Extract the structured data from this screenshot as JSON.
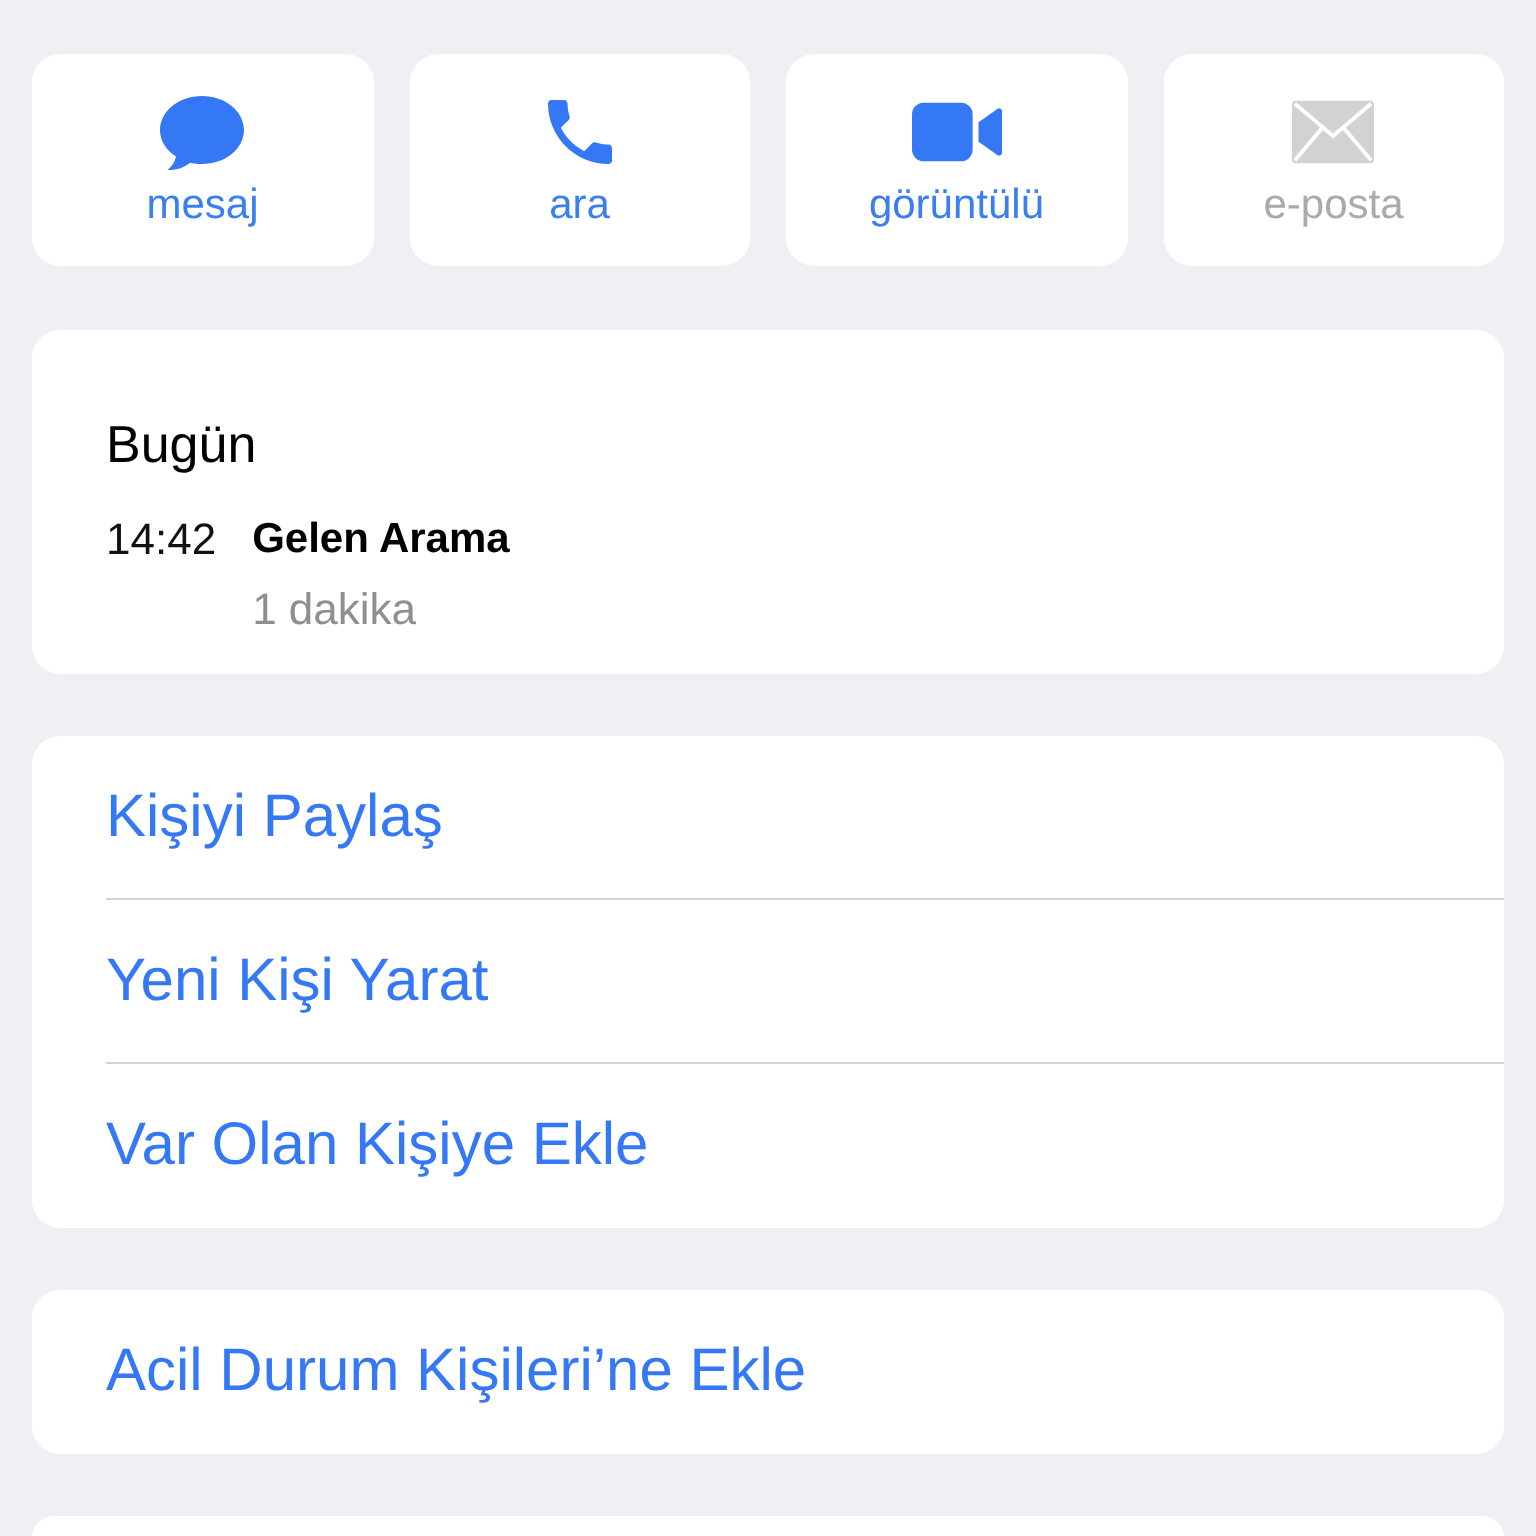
{
  "actions": [
    {
      "kind": "message",
      "label": "mesaj",
      "disabled": false
    },
    {
      "kind": "call",
      "label": "ara",
      "disabled": false
    },
    {
      "kind": "video",
      "label": "görüntülü",
      "disabled": false
    },
    {
      "kind": "mail",
      "label": "e-posta",
      "disabled": true
    }
  ],
  "history": {
    "heading": "Bugün",
    "entries": [
      {
        "time": "14:42",
        "title": "Gelen Arama",
        "detail": "1 dakika"
      }
    ]
  },
  "groups": [
    {
      "items": [
        "Kişiyi Paylaş",
        "Yeni Kişi Yarat",
        "Var Olan Kişiye Ekle"
      ]
    },
    {
      "items": [
        "Acil Durum Kişileri’ne Ekle"
      ]
    }
  ]
}
